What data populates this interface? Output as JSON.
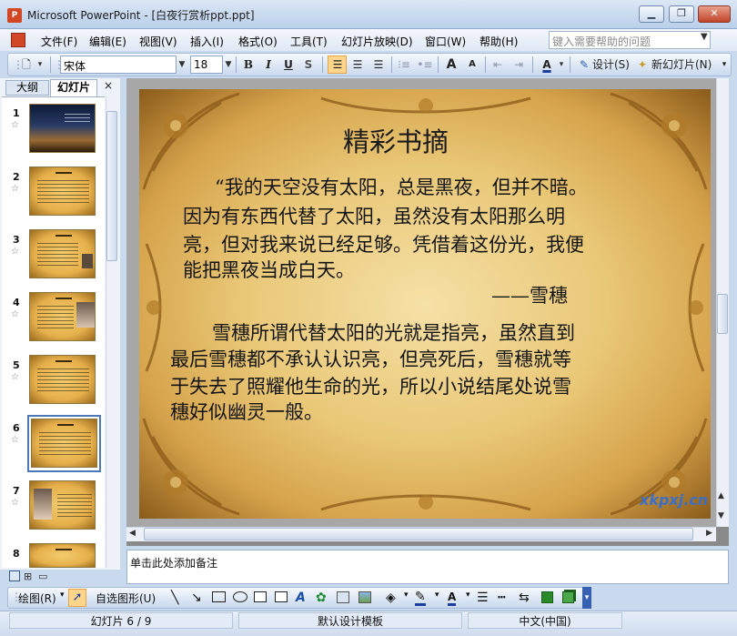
{
  "window": {
    "title": "Microsoft PowerPoint - [白夜行赏析ppt.ppt]",
    "minimize": "▁",
    "restore": "❐",
    "close": "✕"
  },
  "menu": {
    "items": [
      "文件(F)",
      "编辑(E)",
      "视图(V)",
      "插入(I)",
      "格式(O)",
      "工具(T)",
      "幻灯片放映(D)",
      "窗口(W)",
      "帮助(H)"
    ],
    "help_placeholder": "键入需要帮助的问题"
  },
  "toolbar": {
    "font_name": "宋体",
    "font_size": "18",
    "bold": "B",
    "italic": "I",
    "underline": "U",
    "shadow": "S",
    "grow_font": "A",
    "shrink_font": "A",
    "font_color": "A",
    "design_label": "设计(S)",
    "new_slide_label": "新幻灯片(N)"
  },
  "panel": {
    "tabs": [
      "大纲",
      "幻灯片"
    ],
    "close": "×",
    "slide_numbers": [
      "1",
      "2",
      "3",
      "4",
      "5",
      "6",
      "7",
      "8"
    ],
    "selected_slide": 6
  },
  "slide": {
    "title": "精彩书摘",
    "paragraph1_lines": [
      "“我的天空没有太阳，总是黑夜，但并不暗。",
      "因为有东西代替了太阳，虽然没有太阳那么明",
      "亮，但对我来说已经足够。凭借着这份光，我便",
      "能把黑夜当成白天。"
    ],
    "attribution": "——雪穗",
    "paragraph2_lines": [
      "雪穗所谓代替太阳的光就是指亮，虽然直到",
      "最后雪穗都不承认认识亮，但亮死后，雪穗就等",
      "于失去了照耀他生命的光，所以小说结尾处说雪",
      "穗好似幽灵一般。"
    ],
    "watermark": "xkpxj.cn"
  },
  "notes": {
    "placeholder": "单击此处添加备注"
  },
  "drawing_toolbar": {
    "draw_label": "绘图(R)",
    "autoshapes_label": "自选图形(U)"
  },
  "status": {
    "slide_position": "幻灯片 6 / 9",
    "template": "默认设计模板",
    "language": "中文(中国)"
  },
  "colors": {
    "accent_blue": "#4b78b8",
    "slide_parchment": "#e9c877",
    "office_red": "#d24726"
  }
}
